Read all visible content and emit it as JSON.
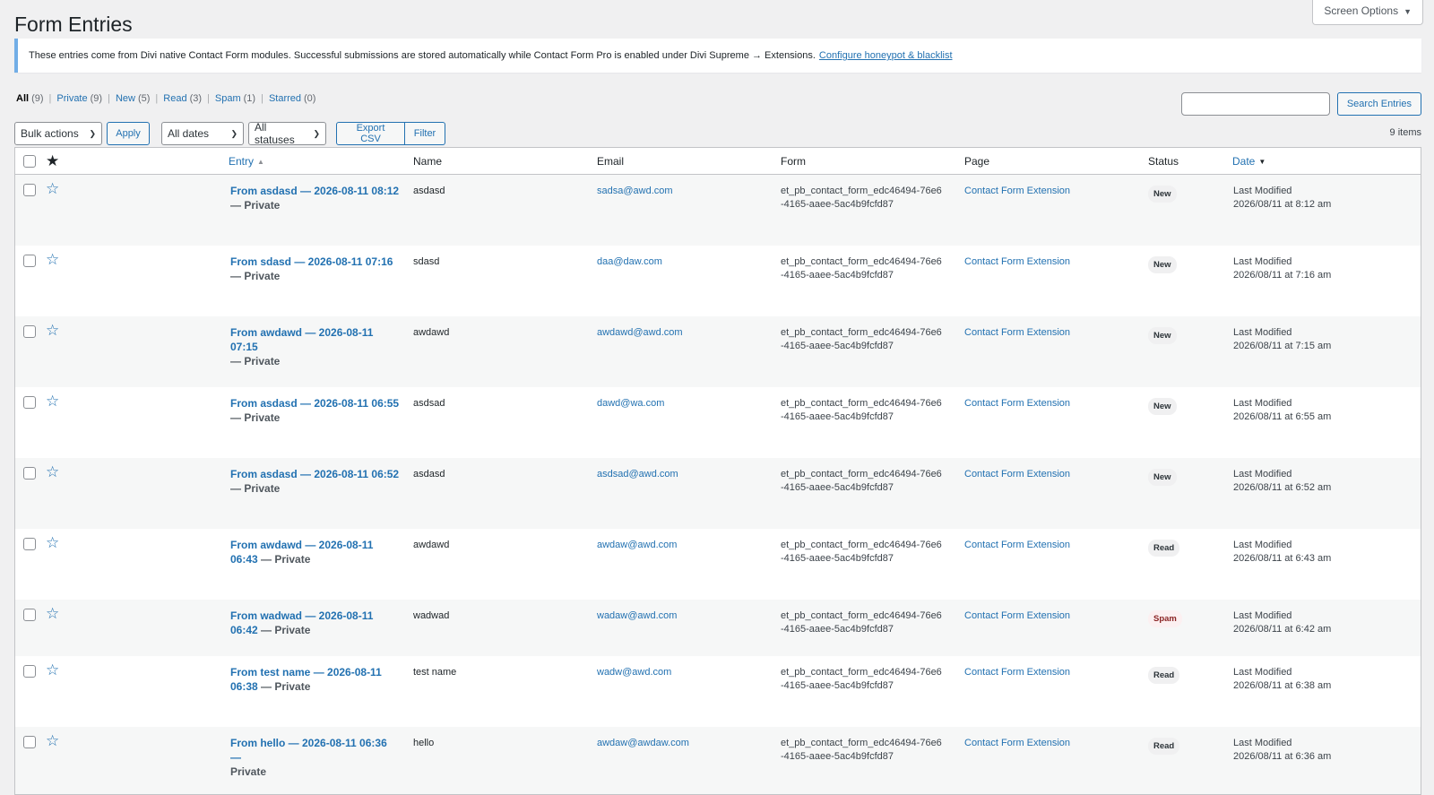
{
  "page": {
    "title": "Form Entries",
    "screen_options": "Screen Options"
  },
  "notice": {
    "text": "These entries come from Divi native Contact Form modules. Successful submissions are stored automatically while Contact Form Pro is enabled under Divi Supreme → Extensions.",
    "link": "Configure honeypot & blacklist"
  },
  "views": [
    {
      "label": "All",
      "count": "(9)",
      "current": true
    },
    {
      "label": "Private",
      "count": "(9)"
    },
    {
      "label": "New",
      "count": "(5)"
    },
    {
      "label": "Read",
      "count": "(3)"
    },
    {
      "label": "Spam",
      "count": "(1)"
    },
    {
      "label": "Starred",
      "count": "(0)"
    }
  ],
  "search": {
    "placeholder": "",
    "button": "Search Entries"
  },
  "toolbar": {
    "bulk_actions": "Bulk actions",
    "apply": "Apply",
    "dates": "All dates",
    "statuses": "All statuses",
    "export": "Export CSV",
    "filter": "Filter",
    "items_count": "9 items"
  },
  "columns": {
    "entry": "Entry",
    "name": "Name",
    "email": "Email",
    "form": "Form",
    "page": "Page",
    "status": "Status",
    "date": "Date"
  },
  "icons": {
    "star_filled": "star-filled-icon",
    "star_outline": "star-outline-icon",
    "sort": "sort-icon",
    "chevron": "chevron-down-icon"
  },
  "rows": [
    {
      "entry_line1": "From asdasd — 2026-08-11 08:12",
      "entry_line2_link": "",
      "entry_line2_text": "— Private",
      "name": "asdasd",
      "email": "sadsa@awd.com",
      "form_l1": "et_pb_contact_form_edc46494-76e6",
      "form_l2": "-4165-aaee-5ac4b9fcfd87",
      "page": "Contact Form Extension",
      "status": "New",
      "date_l1": "Last Modified",
      "date_l2": "2026/08/11 at 8:12 am"
    },
    {
      "entry_line1": "From sdasd — 2026-08-11 07:16",
      "entry_line2_link": "",
      "entry_line2_text": "— Private",
      "name": "sdasd",
      "email": "daa@daw.com",
      "form_l1": "et_pb_contact_form_edc46494-76e6",
      "form_l2": "-4165-aaee-5ac4b9fcfd87",
      "page": "Contact Form Extension",
      "status": "New",
      "date_l1": "Last Modified",
      "date_l2": "2026/08/11 at 7:16 am"
    },
    {
      "entry_line1": "From awdawd — 2026-08-11 07:15",
      "entry_line2_link": "",
      "entry_line2_text": "— Private",
      "name": "awdawd",
      "email": "awdawd@awd.com",
      "form_l1": "et_pb_contact_form_edc46494-76e6",
      "form_l2": "-4165-aaee-5ac4b9fcfd87",
      "page": "Contact Form Extension",
      "status": "New",
      "date_l1": "Last Modified",
      "date_l2": "2026/08/11 at 7:15 am"
    },
    {
      "entry_line1": "From asdasd — 2026-08-11 06:55",
      "entry_line2_link": "",
      "entry_line2_text": "— Private",
      "name": "asdsad",
      "email": "dawd@wa.com",
      "form_l1": "et_pb_contact_form_edc46494-76e6",
      "form_l2": "-4165-aaee-5ac4b9fcfd87",
      "page": "Contact Form Extension",
      "status": "New",
      "date_l1": "Last Modified",
      "date_l2": "2026/08/11 at 6:55 am"
    },
    {
      "entry_line1": "From asdasd — 2026-08-11 06:52",
      "entry_line2_link": "",
      "entry_line2_text": "— Private",
      "name": "asdasd",
      "email": "asdsad@awd.com",
      "form_l1": "et_pb_contact_form_edc46494-76e6",
      "form_l2": "-4165-aaee-5ac4b9fcfd87",
      "page": "Contact Form Extension",
      "status": "New",
      "date_l1": "Last Modified",
      "date_l2": "2026/08/11 at 6:52 am"
    },
    {
      "entry_line1": "From awdawd — 2026-08-11",
      "entry_line2_link": "06:43",
      "entry_line2_text": " — Private",
      "name": "awdawd",
      "email": "awdaw@awd.com",
      "form_l1": "et_pb_contact_form_edc46494-76e6",
      "form_l2": "-4165-aaee-5ac4b9fcfd87",
      "page": "Contact Form Extension",
      "status": "Read",
      "date_l1": "Last Modified",
      "date_l2": "2026/08/11 at 6:43 am"
    },
    {
      "entry_line1": "From wadwad — 2026-08-11",
      "entry_line2_link": "06:42",
      "entry_line2_text": " — Private",
      "name": "wadwad",
      "email": "wadaw@awd.com",
      "form_l1": "et_pb_contact_form_edc46494-76e6",
      "form_l2": "-4165-aaee-5ac4b9fcfd87",
      "page": "Contact Form Extension",
      "status": "Spam",
      "date_l1": "Last Modified",
      "date_l2": "2026/08/11 at 6:42 am"
    },
    {
      "entry_line1": "From test name — 2026-08-11",
      "entry_line2_link": "06:38",
      "entry_line2_text": " — Private",
      "name": "test name",
      "email": "wadw@awd.com",
      "form_l1": "et_pb_contact_form_edc46494-76e6",
      "form_l2": "-4165-aaee-5ac4b9fcfd87",
      "page": "Contact Form Extension",
      "status": "Read",
      "date_l1": "Last Modified",
      "date_l2": "2026/08/11 at 6:38 am"
    },
    {
      "entry_line1": "From hello — 2026-08-11 06:36 —",
      "entry_line2_link": "",
      "entry_line2_text": "Private",
      "name": "hello",
      "email": "awdaw@awdaw.com",
      "form_l1": "et_pb_contact_form_edc46494-76e6",
      "form_l2": "-4165-aaee-5ac4b9fcfd87",
      "page": "Contact Form Extension",
      "status": "Read",
      "date_l1": "Last Modified",
      "date_l2": "2026/08/11 at 6:36 am"
    }
  ]
}
